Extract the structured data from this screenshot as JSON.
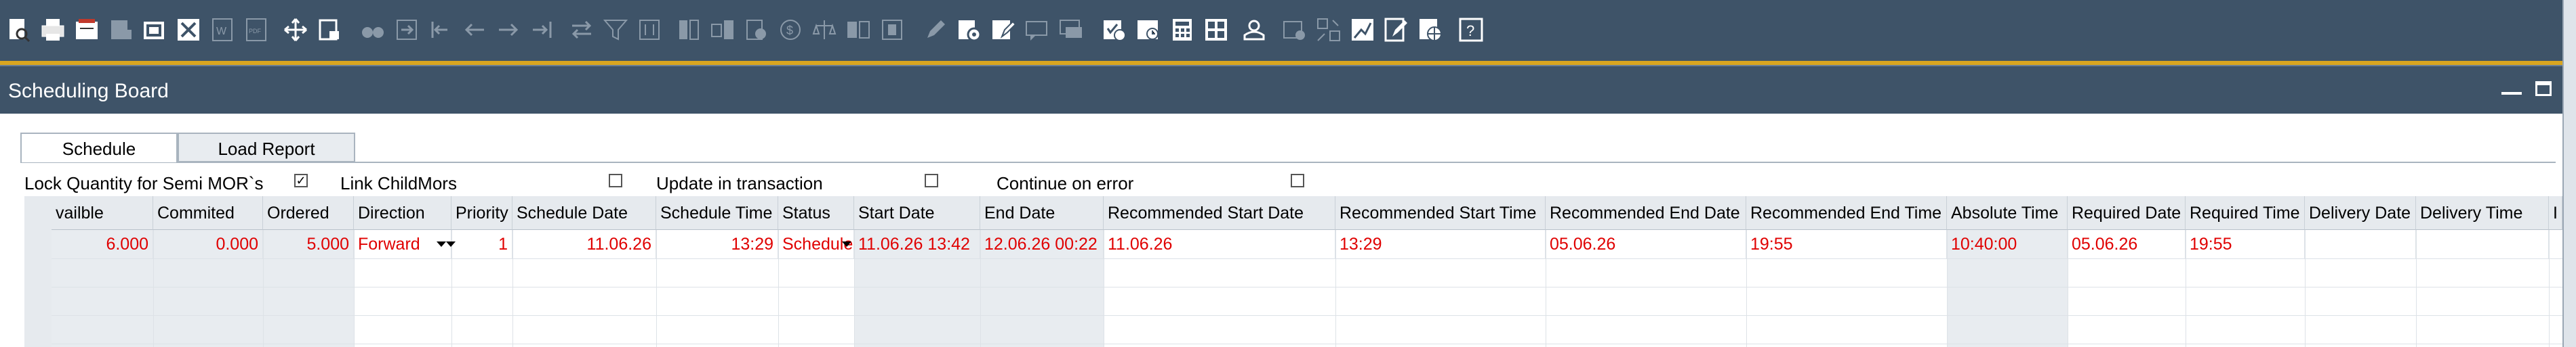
{
  "toolbar": {
    "icons": [
      "find-icon",
      "print-icon",
      "print-preview-icon",
      "send-icon",
      "copy-icon",
      "excel-export-icon",
      "word-export-icon",
      "pdf-export-icon",
      "move-icon",
      "lock-icon",
      "binoculars-icon",
      "import-icon",
      "first-record-icon",
      "previous-record-icon",
      "next-record-icon",
      "last-record-icon",
      "refresh-icon",
      "filter-icon",
      "sort-icon",
      "settings-icon",
      "relation-map-icon",
      "currency-icon",
      "base-document-icon",
      "target-document-icon",
      "edit-icon",
      "form-settings-icon",
      "layout-designer-icon",
      "message-icon",
      "alert-icon",
      "calendar-icon",
      "clock-icon",
      "calculator-icon",
      "queries-icon",
      "user-icon",
      "lock-screen-icon",
      "drag-icon",
      "chart-icon",
      "edit-form-icon",
      "web-icon",
      "help-icon"
    ]
  },
  "window": {
    "title": "Scheduling Board"
  },
  "tabs": [
    {
      "label": "Schedule",
      "active": true
    },
    {
      "label": "Load Report",
      "active": false
    }
  ],
  "options": [
    {
      "label": "Lock Quantity for Semi MOR`s",
      "checked": true,
      "check_mark": "✓"
    },
    {
      "label": "Link ChildMors",
      "checked": false,
      "check_mark": ""
    },
    {
      "label": "Update in transaction",
      "checked": false,
      "check_mark": ""
    },
    {
      "label": "Continue on error",
      "checked": false,
      "check_mark": ""
    }
  ],
  "grid": {
    "columns": [
      "vailble",
      "Commited",
      "Ordered",
      "Direction",
      "Priority",
      "Schedule Date",
      "Schedule Time",
      "Status",
      "Start Date",
      "End Date",
      "Recommended Start Date",
      "Recommended Start Time",
      "Recommended End Date",
      "Recommended End Time",
      "Absolute Time",
      "Required Date",
      "Required Time",
      "Delivery Date",
      "Delivery Time",
      "I"
    ],
    "row": {
      "available": "6.000",
      "committed": "0.000",
      "ordered": "5.000",
      "direction": "Forward",
      "priority": "1",
      "schedule_date": "11.06.26",
      "schedule_time": "13:29",
      "status": "Scheduled",
      "start_date": "11.06.26 13:42",
      "end_date": "12.06.26 00:22",
      "rec_start_date": "11.06.26",
      "rec_start_time": "13:29",
      "rec_end_date": "05.06.26",
      "rec_end_time": "19:55",
      "absolute_time": "10:40:00",
      "required_date": "05.06.26",
      "required_time": "19:55",
      "delivery_date": "",
      "delivery_time": ""
    }
  },
  "colors": {
    "toolbar_bg": "#3e5368",
    "accent_line": "#d9a520",
    "value_text": "#e00000"
  }
}
